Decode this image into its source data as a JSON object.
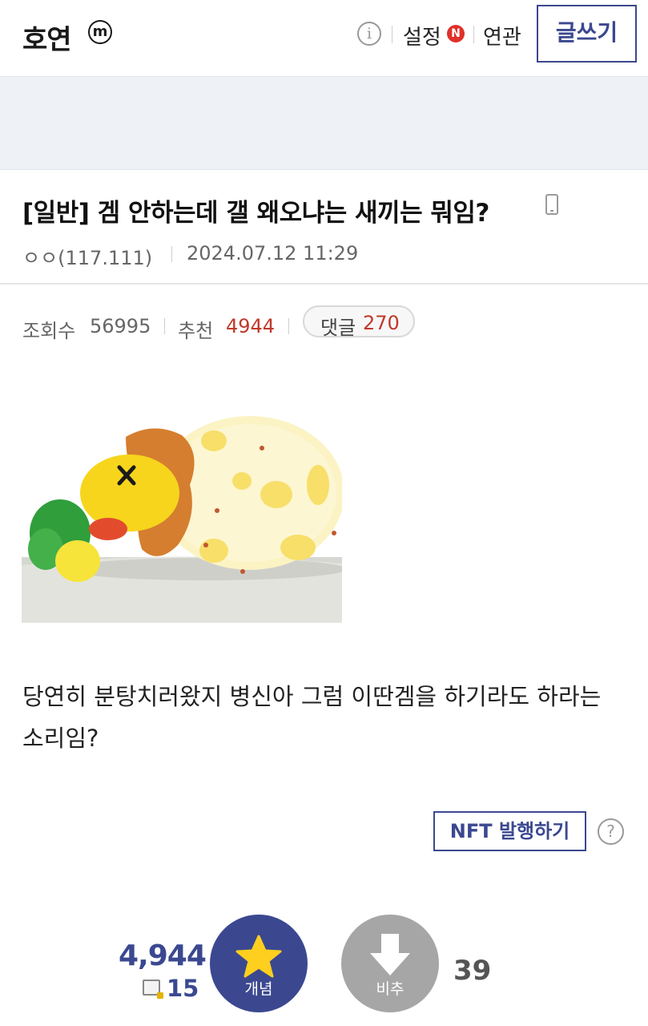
{
  "header": {
    "gallery_title": "호연",
    "minor_badge": "m",
    "settings_label": "설정",
    "settings_badge": "N",
    "related_label": "연관",
    "write_button": "글쓰기"
  },
  "post": {
    "title": "[일반] 겜 안하는데 갤 왜오냐는 새끼는 뭐임?",
    "author": "ㅇㅇ(117.111)",
    "date": "2024.07.12 11:29",
    "views_label": "조회수",
    "views": "56995",
    "recommend_label": "추천",
    "recommend": "4944",
    "comments_label": "댓글",
    "comments": "270",
    "body": "당연히 분탕치러왔지 병신아 그럼 이딴겜을 하기라도 하라는 소리임?",
    "image_alt": "knocked-out yellow cartoon creature with orange mane lying next to a green bush"
  },
  "actions": {
    "nft_button": "NFT 발행하기",
    "help": "?"
  },
  "votes": {
    "upvote_total": "4,944",
    "fixed_count": "15",
    "upvote_label": "개념",
    "downvote_label": "비추",
    "downvote_count": "39"
  },
  "colors": {
    "accent": "#3b4890",
    "red_value": "#c0392b",
    "badge_red": "#e0302a",
    "downvote_gray": "#a6a6a6",
    "ad_band": "#eef1f6"
  }
}
